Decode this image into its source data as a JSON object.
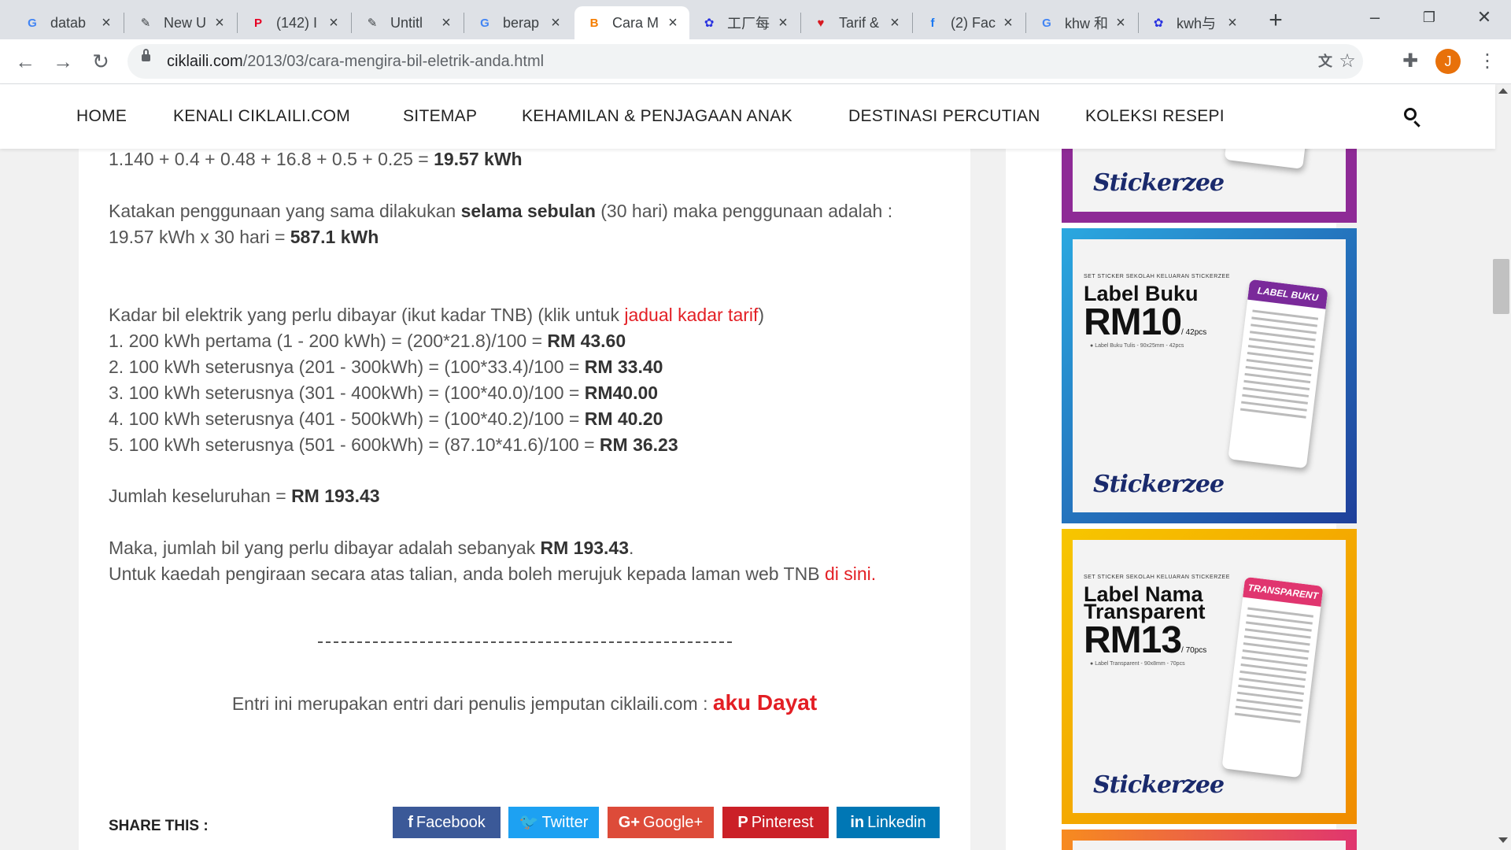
{
  "browser": {
    "tabs": [
      {
        "label": "datab",
        "icon": "google-icon",
        "icon_glyph": "G",
        "icon_color": "#4285f4"
      },
      {
        "label": "New U",
        "icon": "brush-icon",
        "icon_glyph": "✎",
        "icon_color": "#3c4043"
      },
      {
        "label": "(142) I",
        "icon": "pinterest-icon",
        "icon_glyph": "P",
        "icon_color": "#e60023"
      },
      {
        "label": "Untitl",
        "icon": "brush-icon",
        "icon_glyph": "✎",
        "icon_color": "#3c4043"
      },
      {
        "label": "berap",
        "icon": "google-icon",
        "icon_glyph": "G",
        "icon_color": "#4285f4"
      },
      {
        "label": "Cara M",
        "icon": "blogger-icon",
        "icon_glyph": "B",
        "icon_color": "#f57d00"
      },
      {
        "label": "工厂每",
        "icon": "baidu-icon",
        "icon_glyph": "✿",
        "icon_color": "#2932e1"
      },
      {
        "label": "Tarif &",
        "icon": "tnb-icon",
        "icon_glyph": "♥",
        "icon_color": "#d71921"
      },
      {
        "label": "(2) Fac",
        "icon": "facebook-icon",
        "icon_glyph": "f",
        "icon_color": "#1877f2"
      },
      {
        "label": "khw 和",
        "icon": "google-icon",
        "icon_glyph": "G",
        "icon_color": "#4285f4"
      },
      {
        "label": "kwh与",
        "icon": "baidu-icon",
        "icon_glyph": "✿",
        "icon_color": "#2932e1"
      }
    ],
    "active_tab_index": 5,
    "url_host": "ciklaili.com",
    "url_path": "/2013/03/cara-mengira-bil-eletrik-anda.html",
    "profile_initial": "J"
  },
  "sitenav": {
    "items": [
      "HOME",
      "KENALI CIKLAILI.COM",
      "SITEMAP",
      "KEHAMILAN & PENJAGAAN ANAK",
      "DESTINASI PERCUTIAN",
      "KOLEKSI RESEPI"
    ]
  },
  "article": {
    "sum_line_prefix": "1.140 + 0.4 + 0.48 + 16.8 + 0.5 + 0.25 = ",
    "sum_line_value": "19.57 kWh",
    "monthly_p1": "Katakan penggunaan yang sama dilakukan ",
    "monthly_bold": "selama sebulan",
    "monthly_p2": " (30 hari) maka penggunaan adalah :",
    "monthly_calc_prefix": "19.57 kWh x 30 hari = ",
    "monthly_calc_value": "587.1 kWh",
    "rate_intro_prefix": "Kadar bil elektrik yang perlu dibayar (ikut kadar TNB) (klik untuk ",
    "rate_intro_link": "jadual kadar tarif",
    "rate_intro_suffix": ")",
    "tiers": [
      {
        "text": "1. 200 kWh pertama (1 - 200 kWh) = (200*21.8)/100 =  ",
        "amount": "RM 43.60"
      },
      {
        "text": "2. 100 kWh seterusnya (201 - 300kWh) = (100*33.4)/100 = ",
        "amount": "RM 33.40"
      },
      {
        "text": "3. 100 kWh seterusnya (301 - 400kWh) = (100*40.0)/100 = ",
        "amount": "RM40.00"
      },
      {
        "text": "4. 100 kWh seterusnya (401 - 500kWh) = (100*40.2)/100 = ",
        "amount": "RM 40.20"
      },
      {
        "text": "5. 100 kWh seterusnya (501 - 600kWh) = (87.10*41.6)/100 = ",
        "amount": "RM 36.23"
      }
    ],
    "total_prefix": "Jumlah keseluruhan = ",
    "total_value": "RM 193.43",
    "conclusion_prefix": "Maka, jumlah bil yang perlu dibayar adalah sebanyak ",
    "conclusion_value": "RM 193.43",
    "conclusion_suffix": ".",
    "online_text": "Untuk kaedah pengiraan secara atas talian, anda boleh merujuk kepada laman web TNB ",
    "online_link": "di sini",
    "online_suffix": ".",
    "credit_prefix": "Entri ini merupakan entri dari penulis jemputan ciklaili.com : ",
    "credit_author": "aku Dayat"
  },
  "share": {
    "label": "SHARE THIS :",
    "buttons": [
      {
        "label": "Facebook",
        "glyph": "f",
        "color": "#3b5998"
      },
      {
        "label": "Twitter",
        "glyph": "🐦",
        "color": "#1da1f2"
      },
      {
        "label": "Google+",
        "glyph": "G+",
        "color": "#dd4b39"
      },
      {
        "label": "Pinterest",
        "glyph": "P",
        "color": "#cb2027"
      },
      {
        "label": "Linkedin",
        "glyph": "in",
        "color": "#0077b5"
      }
    ]
  },
  "sidebar": {
    "ads": [
      {
        "logo": "Stickerzee",
        "frame_color": "#8e2a96"
      },
      {
        "kicker": "SET STICKER SEKOLAH KELUARAN STICKERZEE",
        "title": "Label Buku",
        "price": "RM10",
        "qty": "/ 42pcs",
        "bullet": "Label Buku Tulis - 90x25mm - 42pcs",
        "tag": "LABEL BUKU",
        "logo": "Stickerzee",
        "frame_color": "#1f5fb6"
      },
      {
        "kicker": "SET STICKER SEKOLAH KELUARAN STICKERZEE",
        "title": "Label Nama Transparent",
        "price": "RM13",
        "qty": "/ 70pcs",
        "bullet": "Label Transparent - 90x8mm - 70pcs",
        "tag": "TRANSPARENT",
        "logo": "Stickerzee",
        "frame_color": "#f4a300"
      }
    ]
  }
}
